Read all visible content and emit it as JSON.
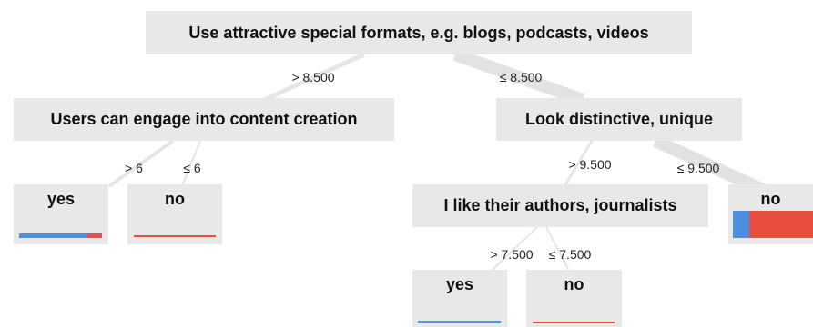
{
  "colors": {
    "node_bg": "#e8e8e8",
    "edge": "#e5e5e5",
    "class_yes": "#4a8fe0",
    "class_no": "#e84f3f"
  },
  "nodes": {
    "root": {
      "label": "Use attractive special formats, e.g. blogs, podcasts, videos"
    },
    "engage": {
      "label": "Users can engage into content creation"
    },
    "distinct": {
      "label": "Look distinctive, unique"
    },
    "authors": {
      "label": "I like their authors, journalists"
    },
    "leaf_engage_yes": {
      "label": "yes",
      "class_share": {
        "yes": 0.82,
        "no": 0.18
      }
    },
    "leaf_engage_no": {
      "label": "no",
      "class_share": {
        "yes": 0.0,
        "no": 1.0
      }
    },
    "leaf_distinct_no": {
      "label": "no",
      "class_share": {
        "yes": 0.2,
        "no": 0.8
      }
    },
    "leaf_authors_yes": {
      "label": "yes",
      "class_share": {
        "yes": 1.0,
        "no": 0.0
      }
    },
    "leaf_authors_no": {
      "label": "no",
      "class_share": {
        "yes": 0.0,
        "no": 1.0
      }
    }
  },
  "edges": {
    "root_gt": "> 8.500",
    "root_le": "≤ 8.500",
    "engage_gt": "> 6",
    "engage_le": "≤ 6",
    "distinct_gt": "> 9.500",
    "distinct_le": "≤ 9.500",
    "authors_gt": "> 7.500",
    "authors_le": "≤ 7.500"
  }
}
